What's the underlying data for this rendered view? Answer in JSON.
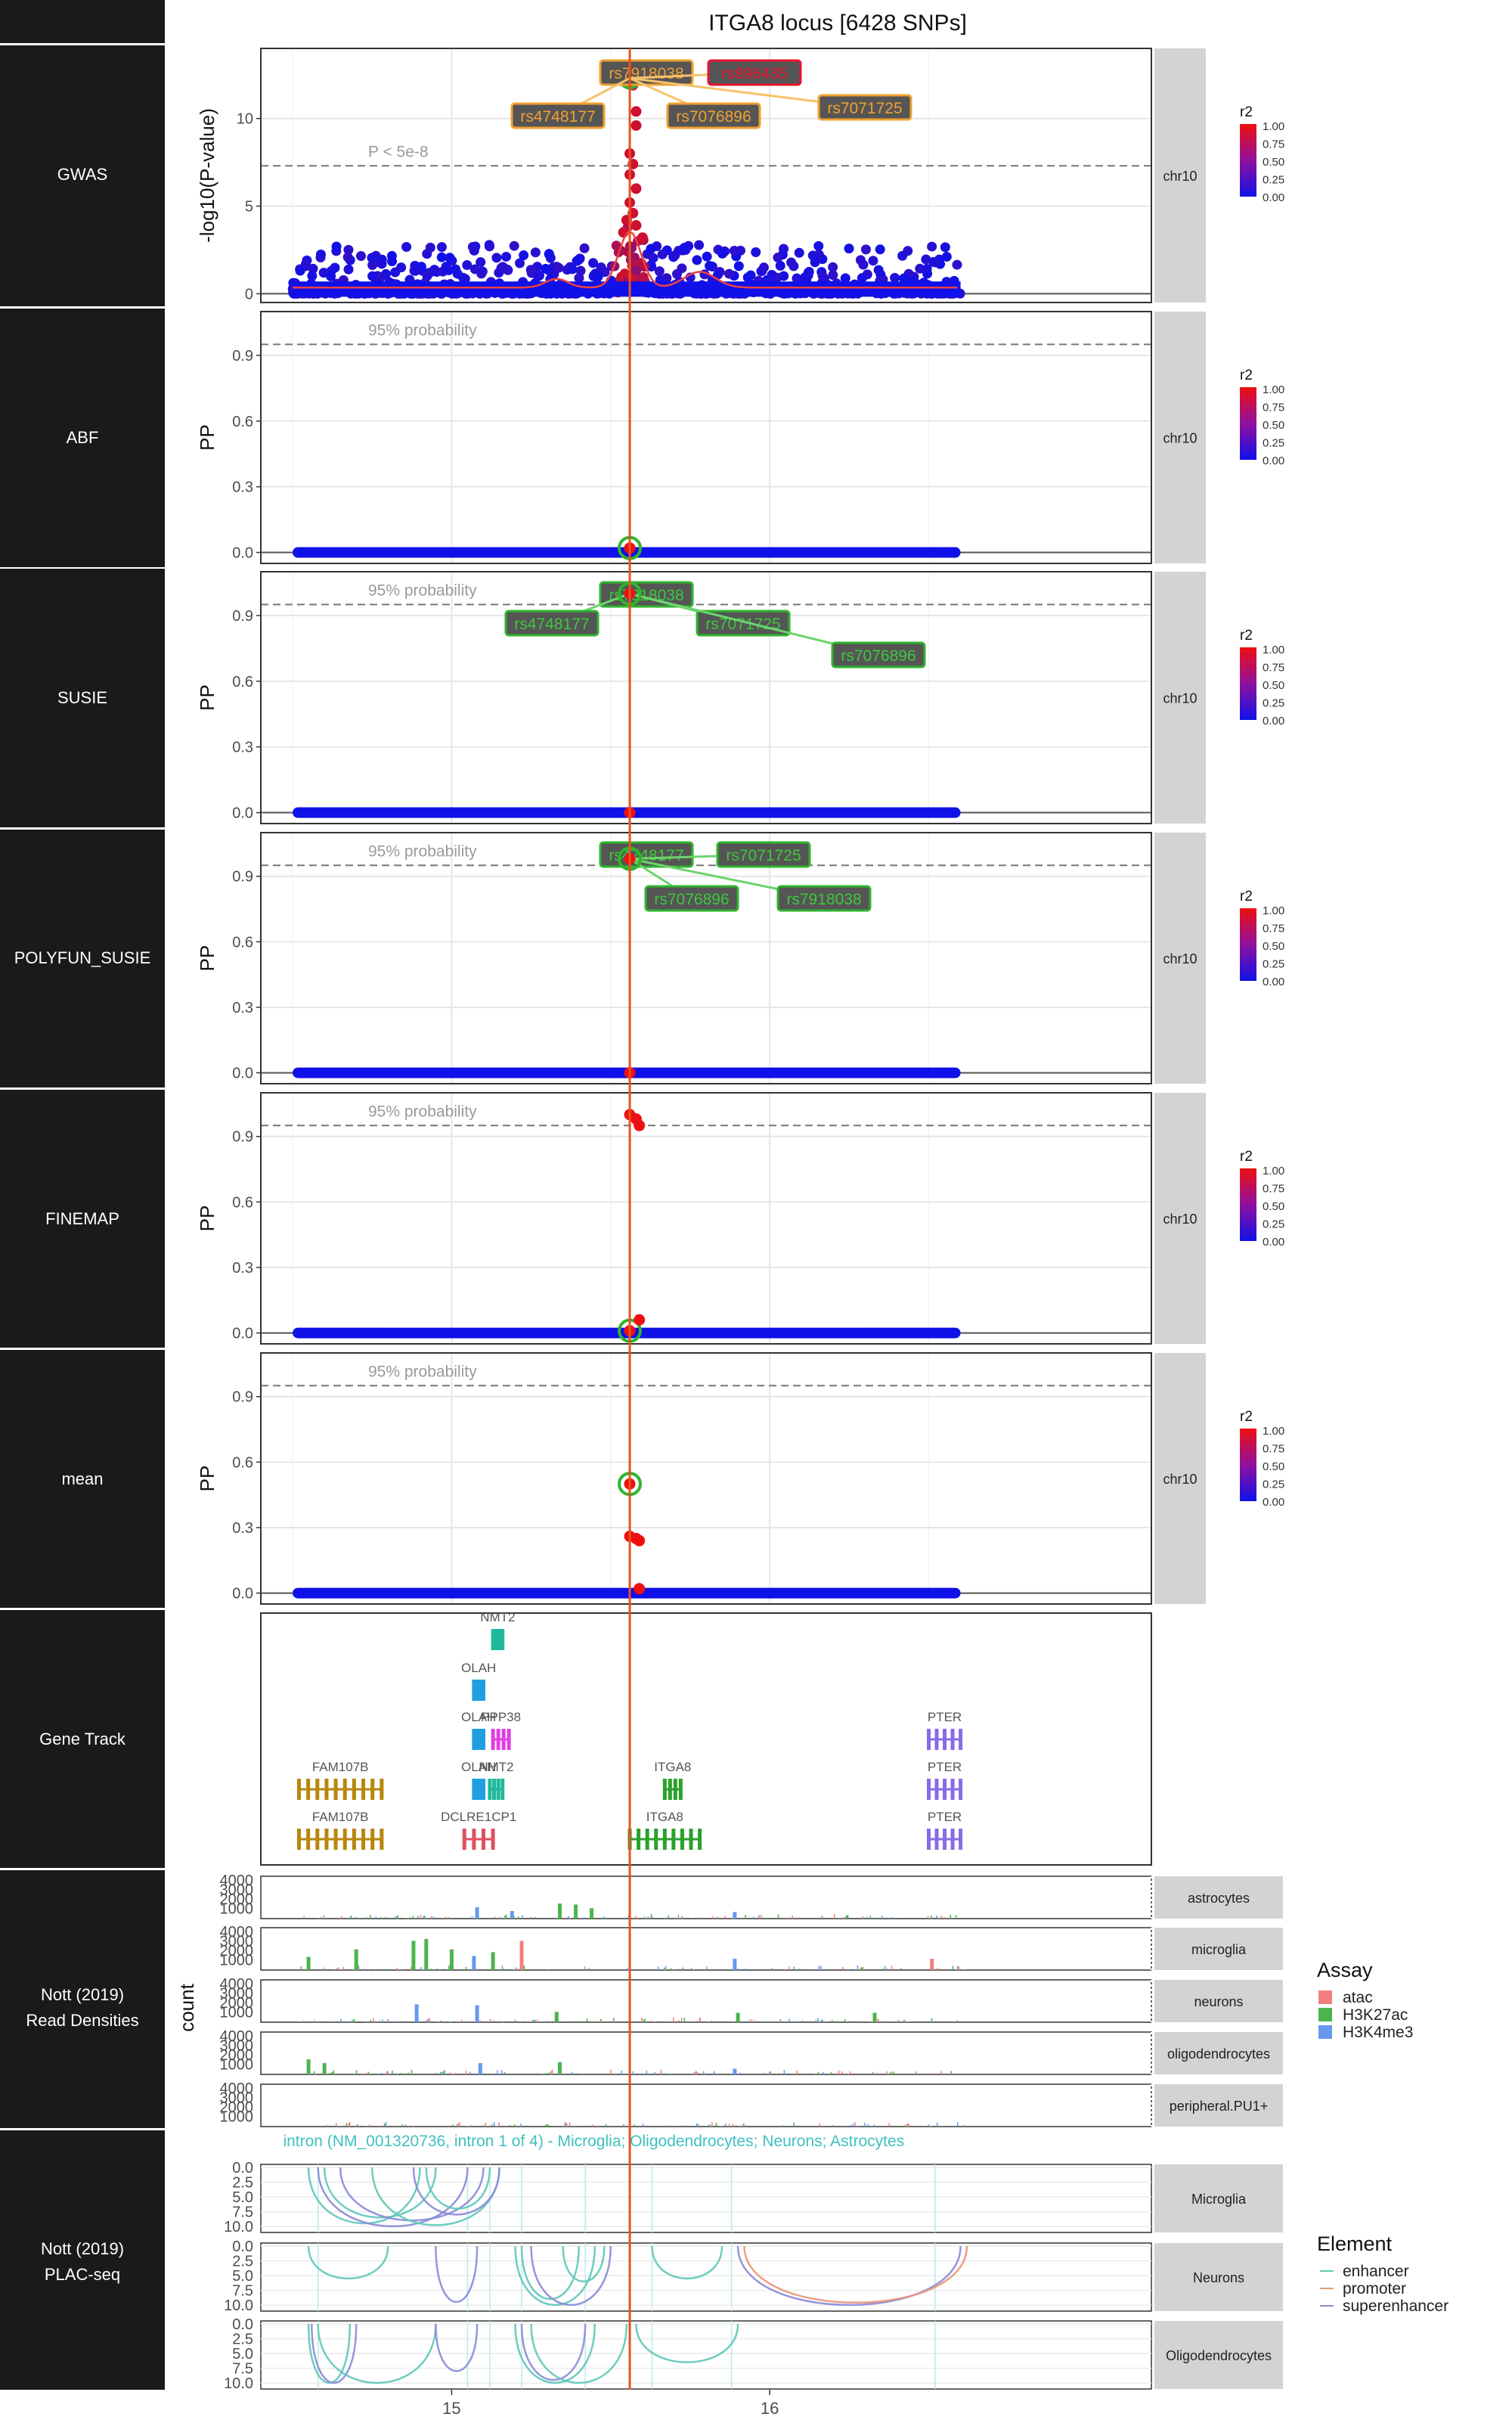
{
  "title": "ITGA8 locus [6428 SNPs]",
  "colors": {
    "row_label_bg": "#1a1a1a",
    "strip_bg": "#d3d3d3",
    "lead_line": "#e8531f",
    "credible_ring": "#2db52d",
    "label_orange": "#f0a030",
    "label_green": "#2e7d32",
    "label_red": "#e8142e",
    "low_r2": "#1010e8",
    "high_r2": "#ee1010",
    "atac": "#f08080",
    "H3K27ac": "#4db34d",
    "H3K4me3": "#6699ee",
    "enhancer": "#5ec8b8",
    "promoter": "#e9967a",
    "superenhancer": "#8a8ad8",
    "gene_FAM107B": "#b8860b",
    "gene_OLAH": "#1f9fe0",
    "gene_NMT2": "#20b89a",
    "gene_PPP38": "#e040e0",
    "gene_DCLRE1CP1": "#e05060",
    "gene_ITGA8": "#2ca02c",
    "gene_PTER": "#8a6ae8"
  },
  "row_labels": [
    "GWAS",
    "ABF",
    "SUSIE",
    "POLYFUN_SUSIE",
    "FINEMAP",
    "mean",
    "Gene Track",
    "Nott (2019)\nRead Densities",
    "Nott (2019)\nPLAC-seq"
  ],
  "strip_chr": "chr10",
  "legend_r2": {
    "title": "r2",
    "ticks": [
      "1.00",
      "0.75",
      "0.50",
      "0.25",
      "0.00"
    ]
  },
  "legend_assay": {
    "title": "Assay",
    "items": [
      "atac",
      "H3K27ac",
      "H3K4me3"
    ]
  },
  "legend_element": {
    "title": "Element",
    "items": [
      "enhancer",
      "promoter",
      "superenhancer"
    ]
  },
  "x_axis": {
    "ticks": [
      "15",
      "16"
    ],
    "tick_values": [
      15,
      16
    ],
    "range": [
      14.4,
      17.2
    ]
  },
  "chart_data": [
    {
      "type": "scatter",
      "panel": "GWAS",
      "ylabel": "-log10(P-value)",
      "yticks": [
        "0",
        "5",
        "10"
      ],
      "ytick_values": [
        0,
        5,
        10
      ],
      "ylim": [
        -0.5,
        14
      ],
      "threshold": {
        "y": 7.3,
        "label": "P < 5e-8"
      },
      "lead_snp_x": 15.56,
      "snp_x_range": [
        14.5,
        16.6
      ],
      "peak_points": [
        {
          "x": 15.56,
          "y": 12.3
        },
        {
          "x": 15.57,
          "y": 11.9
        },
        {
          "x": 15.58,
          "y": 10.4
        },
        {
          "x": 15.58,
          "y": 9.6
        },
        {
          "x": 15.56,
          "y": 8.0
        },
        {
          "x": 15.57,
          "y": 7.4
        },
        {
          "x": 15.56,
          "y": 6.8
        },
        {
          "x": 15.58,
          "y": 6.0
        },
        {
          "x": 15.56,
          "y": 5.2
        },
        {
          "x": 15.57,
          "y": 4.6
        },
        {
          "x": 15.55,
          "y": 4.2
        },
        {
          "x": 15.58,
          "y": 3.9
        },
        {
          "x": 15.54,
          "y": 3.5
        },
        {
          "x": 15.6,
          "y": 3.2
        }
      ],
      "annotations": [
        {
          "text": "rs7918038",
          "color": "orange"
        },
        {
          "text": "rs896435",
          "color": "red"
        },
        {
          "text": "rs4748177",
          "color": "orange"
        },
        {
          "text": "rs7076896",
          "color": "orange"
        },
        {
          "text": "rs7071725",
          "color": "orange"
        }
      ]
    },
    {
      "type": "scatter",
      "panel": "ABF",
      "ylabel": "PP",
      "yticks": [
        "0.0",
        "0.3",
        "0.6",
        "0.9"
      ],
      "ytick_values": [
        0,
        0.3,
        0.6,
        0.9
      ],
      "ylim": [
        -0.05,
        1.1
      ],
      "threshold": {
        "y": 0.95,
        "label": "95% probability"
      },
      "points": [
        {
          "x": 15.56,
          "y": 0.02,
          "r2": 1.0,
          "credible": true
        }
      ],
      "annotations": []
    },
    {
      "type": "scatter",
      "panel": "SUSIE",
      "ylabel": "PP",
      "yticks": [
        "0.0",
        "0.3",
        "0.6",
        "0.9"
      ],
      "ytick_values": [
        0,
        0.3,
        0.6,
        0.9
      ],
      "ylim": [
        -0.05,
        1.1
      ],
      "threshold": {
        "y": 0.95,
        "label": "95% probability"
      },
      "points": [
        {
          "x": 15.56,
          "y": 1.0,
          "r2": 1.0,
          "credible": true
        },
        {
          "x": 15.56,
          "y": 0.0,
          "r2": 1.0,
          "credible": false
        }
      ],
      "annotations": [
        {
          "text": "rs7918038",
          "color": "green"
        },
        {
          "text": "rs4748177",
          "color": "green"
        },
        {
          "text": "rs7071725",
          "color": "green"
        },
        {
          "text": "rs7076896",
          "color": "green"
        }
      ]
    },
    {
      "type": "scatter",
      "panel": "POLYFUN_SUSIE",
      "ylabel": "PP",
      "yticks": [
        "0.0",
        "0.3",
        "0.6",
        "0.9"
      ],
      "ytick_values": [
        0,
        0.3,
        0.6,
        0.9
      ],
      "ylim": [
        -0.05,
        1.1
      ],
      "threshold": {
        "y": 0.95,
        "label": "95% probability"
      },
      "points": [
        {
          "x": 15.56,
          "y": 0.98,
          "r2": 1.0,
          "credible": true
        },
        {
          "x": 15.56,
          "y": 0.0,
          "r2": 1.0,
          "credible": false
        }
      ],
      "annotations": [
        {
          "text": "rs4748177",
          "color": "green"
        },
        {
          "text": "rs7071725",
          "color": "green"
        },
        {
          "text": "rs7076896",
          "color": "green"
        },
        {
          "text": "rs7918038",
          "color": "green"
        }
      ]
    },
    {
      "type": "scatter",
      "panel": "FINEMAP",
      "ylabel": "PP",
      "yticks": [
        "0.0",
        "0.3",
        "0.6",
        "0.9"
      ],
      "ytick_values": [
        0,
        0.3,
        0.6,
        0.9
      ],
      "ylim": [
        -0.05,
        1.1
      ],
      "threshold": {
        "y": 0.95,
        "label": "95% probability"
      },
      "points": [
        {
          "x": 15.56,
          "y": 1.0,
          "r2": 1.0,
          "credible": false
        },
        {
          "x": 15.58,
          "y": 0.98,
          "r2": 1.0,
          "credible": false
        },
        {
          "x": 15.59,
          "y": 0.95,
          "r2": 1.0,
          "credible": false
        },
        {
          "x": 15.56,
          "y": 0.01,
          "r2": 1.0,
          "credible": true
        },
        {
          "x": 15.59,
          "y": 0.06,
          "r2": 1.0,
          "credible": false
        }
      ],
      "annotations": []
    },
    {
      "type": "scatter",
      "panel": "mean",
      "ylabel": "PP",
      "yticks": [
        "0.0",
        "0.3",
        "0.6",
        "0.9"
      ],
      "ytick_values": [
        0,
        0.3,
        0.6,
        0.9
      ],
      "ylim": [
        -0.05,
        1.1
      ],
      "threshold": {
        "y": 0.95,
        "label": "95% probability"
      },
      "points": [
        {
          "x": 15.56,
          "y": 0.5,
          "r2": 1.0,
          "credible": true
        },
        {
          "x": 15.56,
          "y": 0.26,
          "r2": 1.0,
          "credible": false
        },
        {
          "x": 15.58,
          "y": 0.25,
          "r2": 1.0,
          "credible": false
        },
        {
          "x": 15.59,
          "y": 0.24,
          "r2": 1.0,
          "credible": false
        },
        {
          "x": 15.59,
          "y": 0.02,
          "r2": 1.0,
          "credible": false
        }
      ],
      "annotations": []
    },
    {
      "type": "table",
      "panel": "Gene Track",
      "genes": [
        {
          "name": "NMT2",
          "start": 15.13,
          "end": 15.16,
          "level": 5,
          "color": "gene_NMT2"
        },
        {
          "name": "OLAH",
          "start": 15.07,
          "end": 15.1,
          "level": 4,
          "color": "gene_OLAH"
        },
        {
          "name": "OLAH",
          "start": 15.07,
          "end": 15.1,
          "level": 3,
          "color": "gene_OLAH"
        },
        {
          "name": "PPP38",
          "start": 15.13,
          "end": 15.18,
          "level": 3,
          "color": "gene_PPP38"
        },
        {
          "name": "PTER",
          "start": 16.5,
          "end": 16.6,
          "level": 3,
          "color": "gene_PTER"
        },
        {
          "name": "FAM107B",
          "start": 14.52,
          "end": 14.78,
          "level": 2,
          "color": "gene_FAM107B"
        },
        {
          "name": "OLAH",
          "start": 15.07,
          "end": 15.1,
          "level": 2,
          "color": "gene_OLAH"
        },
        {
          "name": "NMT2",
          "start": 15.12,
          "end": 15.16,
          "level": 2,
          "color": "gene_NMT2"
        },
        {
          "name": "ITGA8",
          "start": 15.67,
          "end": 15.72,
          "level": 2,
          "color": "gene_ITGA8"
        },
        {
          "name": "PTER",
          "start": 16.5,
          "end": 16.6,
          "level": 2,
          "color": "gene_PTER"
        },
        {
          "name": "FAM107B",
          "start": 14.52,
          "end": 14.78,
          "level": 1,
          "color": "gene_FAM107B"
        },
        {
          "name": "DCLRE1CP1",
          "start": 15.04,
          "end": 15.13,
          "level": 1,
          "color": "gene_DCLRE1CP1"
        },
        {
          "name": "ITGA8",
          "start": 15.56,
          "end": 15.78,
          "level": 1,
          "color": "gene_ITGA8"
        },
        {
          "name": "PTER",
          "start": 16.5,
          "end": 16.6,
          "level": 1,
          "color": "gene_PTER"
        }
      ]
    },
    {
      "type": "bar",
      "panel": "Nott (2019) Read Densities",
      "ylabel": "count",
      "yticks": [
        "1000",
        "2000",
        "3000",
        "4000"
      ],
      "ytick_values": [
        1000,
        2000,
        3000,
        4000
      ],
      "ylim": [
        0,
        4500
      ],
      "tracks": [
        "astrocytes",
        "microglia",
        "neurons",
        "oligodendrocytes",
        "peripheral.PU1+"
      ],
      "peaks": [
        {
          "track": "astrocytes",
          "assay": "H3K27ac",
          "x": 15.34,
          "value": 1600
        },
        {
          "track": "astrocytes",
          "assay": "H3K27ac",
          "x": 15.39,
          "value": 1500
        },
        {
          "track": "astrocytes",
          "assay": "H3K27ac",
          "x": 15.44,
          "value": 1100
        },
        {
          "track": "astrocytes",
          "assay": "H3K4me3",
          "x": 15.08,
          "value": 1200
        },
        {
          "track": "astrocytes",
          "assay": "H3K4me3",
          "x": 15.19,
          "value": 800
        },
        {
          "track": "astrocytes",
          "assay": "H3K4me3",
          "x": 15.89,
          "value": 700
        },
        {
          "track": "microglia",
          "assay": "H3K27ac",
          "x": 14.55,
          "value": 1400
        },
        {
          "track": "microglia",
          "assay": "H3K27ac",
          "x": 14.7,
          "value": 2200
        },
        {
          "track": "microglia",
          "assay": "H3K27ac",
          "x": 14.88,
          "value": 3100
        },
        {
          "track": "microglia",
          "assay": "H3K27ac",
          "x": 14.92,
          "value": 3300
        },
        {
          "track": "microglia",
          "assay": "H3K27ac",
          "x": 15.0,
          "value": 2200
        },
        {
          "track": "microglia",
          "assay": "H3K27ac",
          "x": 15.13,
          "value": 1900
        },
        {
          "track": "microglia",
          "assay": "atac",
          "x": 15.22,
          "value": 3100
        },
        {
          "track": "microglia",
          "assay": "atac",
          "x": 16.51,
          "value": 1200
        },
        {
          "track": "microglia",
          "assay": "H3K4me3",
          "x": 15.07,
          "value": 1500
        },
        {
          "track": "microglia",
          "assay": "H3K4me3",
          "x": 15.89,
          "value": 1200
        },
        {
          "track": "neurons",
          "assay": "H3K4me3",
          "x": 14.89,
          "value": 1900
        },
        {
          "track": "neurons",
          "assay": "H3K4me3",
          "x": 15.08,
          "value": 1800
        },
        {
          "track": "neurons",
          "assay": "H3K27ac",
          "x": 15.33,
          "value": 1100
        },
        {
          "track": "neurons",
          "assay": "H3K27ac",
          "x": 15.9,
          "value": 1000
        },
        {
          "track": "neurons",
          "assay": "H3K27ac",
          "x": 16.33,
          "value": 1000
        },
        {
          "track": "oligodendrocytes",
          "assay": "H3K27ac",
          "x": 14.55,
          "value": 1600
        },
        {
          "track": "oligodendrocytes",
          "assay": "H3K27ac",
          "x": 14.6,
          "value": 1200
        },
        {
          "track": "oligodendrocytes",
          "assay": "H3K27ac",
          "x": 15.34,
          "value": 1300
        },
        {
          "track": "oligodendrocytes",
          "assay": "H3K4me3",
          "x": 15.09,
          "value": 1200
        },
        {
          "track": "oligodendrocytes",
          "assay": "H3K4me3",
          "x": 15.89,
          "value": 600
        },
        {
          "track": "peripheral.PU1+",
          "assay": "H3K27ac",
          "x": 15.3,
          "value": 200
        }
      ]
    },
    {
      "type": "line",
      "panel": "Nott (2019) PLAC-seq",
      "annotation": "intron (NM_001320736, intron 1 of 4) - Microglia; Oligodendrocytes; Neurons; Astrocytes",
      "yticks": [
        "0.0",
        "2.5",
        "5.0",
        "7.5",
        "10.0"
      ],
      "ytick_values": [
        0,
        2.5,
        5,
        7.5,
        10
      ],
      "ylim": [
        0,
        10.5
      ],
      "tracks": [
        "Microglia",
        "Neurons",
        "Oligodendrocytes"
      ],
      "arcs": [
        {
          "track": "Microglia",
          "element": "enhancer",
          "start": 14.55,
          "end": 14.9,
          "depth": 9.5
        },
        {
          "track": "Microglia",
          "element": "superenhancer",
          "start": 14.58,
          "end": 15.05,
          "depth": 10
        },
        {
          "track": "Microglia",
          "element": "enhancer",
          "start": 14.6,
          "end": 14.95,
          "depth": 8.5
        },
        {
          "track": "Microglia",
          "element": "superenhancer",
          "start": 14.65,
          "end": 15.1,
          "depth": 9
        },
        {
          "track": "Microglia",
          "element": "enhancer",
          "start": 14.75,
          "end": 15.15,
          "depth": 9.8
        },
        {
          "track": "Microglia",
          "element": "superenhancer",
          "start": 14.88,
          "end": 15.15,
          "depth": 8
        },
        {
          "track": "Microglia",
          "element": "enhancer",
          "start": 14.92,
          "end": 15.12,
          "depth": 7
        },
        {
          "track": "Neurons",
          "element": "enhancer",
          "start": 14.55,
          "end": 14.8,
          "depth": 5.5
        },
        {
          "track": "Neurons",
          "element": "superenhancer",
          "start": 14.95,
          "end": 15.08,
          "depth": 9.5
        },
        {
          "track": "Neurons",
          "element": "enhancer",
          "start": 15.2,
          "end": 15.45,
          "depth": 10
        },
        {
          "track": "Neurons",
          "element": "enhancer",
          "start": 15.22,
          "end": 15.4,
          "depth": 9
        },
        {
          "track": "Neurons",
          "element": "superenhancer",
          "start": 15.25,
          "end": 15.5,
          "depth": 10
        },
        {
          "track": "Neurons",
          "element": "enhancer",
          "start": 15.35,
          "end": 15.48,
          "depth": 6
        },
        {
          "track": "Neurons",
          "element": "enhancer",
          "start": 15.63,
          "end": 15.85,
          "depth": 5.5
        },
        {
          "track": "Neurons",
          "element": "superenhancer",
          "start": 15.9,
          "end": 16.6,
          "depth": 10
        },
        {
          "track": "Neurons",
          "element": "promoter",
          "start": 15.92,
          "end": 16.62,
          "depth": 9.6
        },
        {
          "track": "Oligodendrocytes",
          "element": "enhancer",
          "start": 14.55,
          "end": 14.68,
          "depth": 10
        },
        {
          "track": "Oligodendrocytes",
          "element": "superenhancer",
          "start": 14.56,
          "end": 14.7,
          "depth": 10
        },
        {
          "track": "Oligodendrocytes",
          "element": "enhancer",
          "start": 14.58,
          "end": 14.95,
          "depth": 10
        },
        {
          "track": "Oligodendrocytes",
          "element": "superenhancer",
          "start": 14.95,
          "end": 15.08,
          "depth": 8
        },
        {
          "track": "Oligodendrocytes",
          "element": "enhancer",
          "start": 15.2,
          "end": 15.45,
          "depth": 10
        },
        {
          "track": "Oligodendrocytes",
          "element": "superenhancer",
          "start": 15.22,
          "end": 15.42,
          "depth": 9.5
        },
        {
          "track": "Oligodendrocytes",
          "element": "enhancer",
          "start": 15.25,
          "end": 15.55,
          "depth": 10
        },
        {
          "track": "Oligodendrocytes",
          "element": "enhancer",
          "start": 15.58,
          "end": 15.9,
          "depth": 6.5
        }
      ]
    }
  ]
}
